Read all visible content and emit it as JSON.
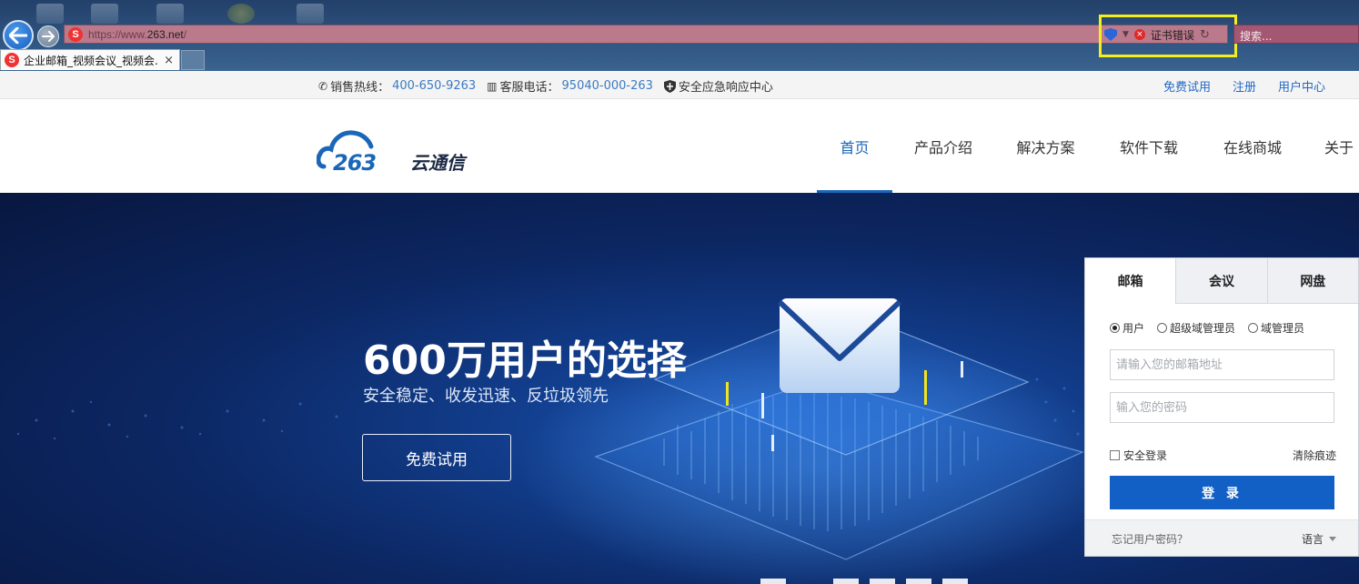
{
  "browser": {
    "url_proto": "https://www.",
    "url_host": "263.net",
    "url_path": "/",
    "cert_error": "证书错误",
    "search_placeholder": "搜索...",
    "tab_title": "企业邮箱_视频会议_视频会...",
    "tab_close": "×",
    "addr_icon": "S"
  },
  "topbar": {
    "sales_label": "销售热线：",
    "sales_number": "400-650-9263",
    "service_label": "客服电话：",
    "service_number": "95040-000-263",
    "security": "安全应急响应中心",
    "links": [
      "免费试用",
      "注册",
      "用户中心"
    ]
  },
  "nav": {
    "items": [
      "首页",
      "产品介绍",
      "解决方案",
      "软件下载",
      "在线商城",
      "关于"
    ],
    "active": 0
  },
  "hero": {
    "title": "600万用户的选择",
    "subtitle": "安全稳定、收发迅速、反垃圾领先",
    "button": "免费试用"
  },
  "login": {
    "tabs": [
      "邮箱",
      "会议",
      "网盘"
    ],
    "roles": [
      "用户",
      "超级域管理员",
      "域管理员"
    ],
    "selected_role": 0,
    "email_placeholder": "请输入您的邮箱地址",
    "password_placeholder": "输入您的密码",
    "safe_login": "安全登录",
    "clear_traces": "清除痕迹",
    "submit": "登 录",
    "forgot": "忘记用户密码？",
    "language": "语言"
  },
  "icons": {
    "back": "back-arrow-icon",
    "forward": "forward-arrow-icon",
    "phone": "phone-icon",
    "fax": "fax-icon",
    "shield": "shield-icon",
    "envelope": "envelope-icon"
  },
  "colors": {
    "brand_blue": "#1a66b8",
    "address_bar": "#bb7a8c",
    "highlight_box": "#f5ee1e",
    "login_button": "#1260c6"
  }
}
